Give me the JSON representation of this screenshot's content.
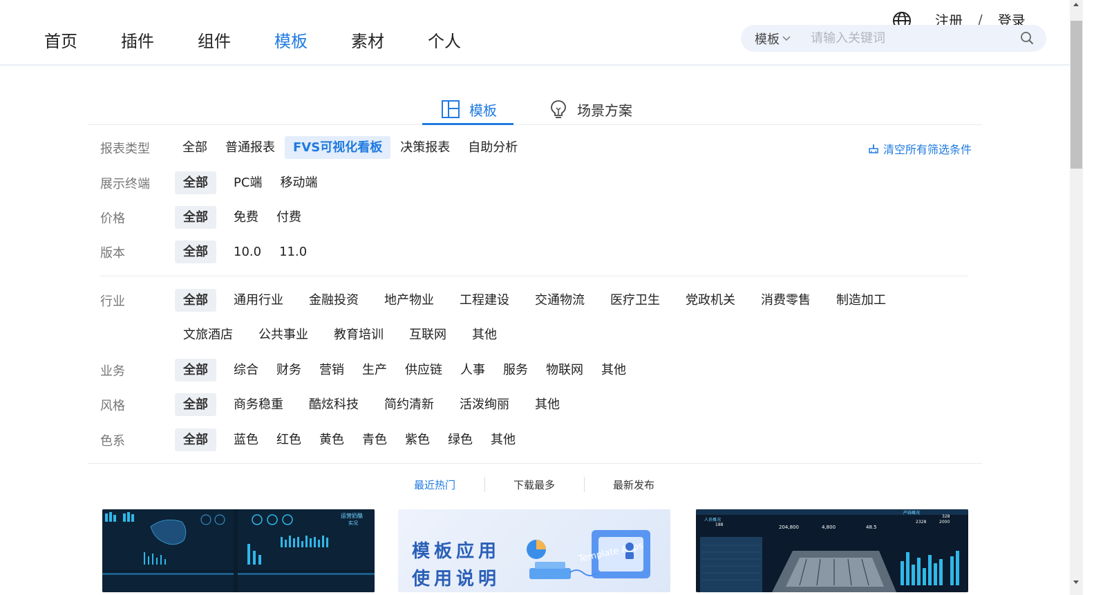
{
  "header": {
    "nav": [
      "首页",
      "插件",
      "组件",
      "模板",
      "素材",
      "个人"
    ],
    "active_nav": "模板",
    "register": "注册",
    "separator": "/",
    "login": "登录",
    "search": {
      "scope": "模板",
      "placeholder": "请输入关键词"
    }
  },
  "tabs": [
    {
      "label": "模板",
      "icon": "layout-icon"
    },
    {
      "label": "场景方案",
      "icon": "lightbulb-icon"
    }
  ],
  "clear_filters": "清空所有筛选条件",
  "filters": {
    "report_type": {
      "label": "报表类型",
      "options": [
        "全部",
        "普通报表",
        "FVS可视化看板",
        "决策报表",
        "自助分析"
      ],
      "selected": "FVS可视化看板"
    },
    "terminal": {
      "label": "展示终端",
      "options": [
        "全部",
        "PC端",
        "移动端"
      ],
      "selected": "全部"
    },
    "price": {
      "label": "价格",
      "options": [
        "全部",
        "免费",
        "付费"
      ],
      "selected": "全部"
    },
    "version": {
      "label": "版本",
      "options": [
        "全部",
        "10.0",
        "11.0"
      ],
      "selected": "全部"
    },
    "industry": {
      "label": "行业",
      "options_row1": [
        "全部",
        "通用行业",
        "金融投资",
        "地产物业",
        "工程建设",
        "交通物流",
        "医疗卫生",
        "党政机关",
        "消费零售",
        "制造加工"
      ],
      "options_row2": [
        "文旅酒店",
        "公共事业",
        "教育培训",
        "互联网",
        "其他"
      ],
      "selected": "全部"
    },
    "business": {
      "label": "业务",
      "options": [
        "全部",
        "综合",
        "财务",
        "营销",
        "生产",
        "供应链",
        "人事",
        "服务",
        "物联网",
        "其他"
      ],
      "selected": "全部"
    },
    "style": {
      "label": "风格",
      "options": [
        "全部",
        "商务稳重",
        "酷炫科技",
        "简约清新",
        "活泼绚丽",
        "其他"
      ],
      "selected": "全部"
    },
    "color": {
      "label": "色系",
      "options": [
        "全部",
        "蓝色",
        "红色",
        "黄色",
        "青色",
        "紫色",
        "绿色",
        "其他"
      ],
      "selected": "全部"
    }
  },
  "sort": [
    "最近热门",
    "下载最多",
    "最新发布"
  ],
  "active_sort": "最近热门",
  "cards": {
    "card2_title_line1": "模板应用",
    "card2_title_line2": "使用说明",
    "card2_badge": "Template Apps",
    "card1_labels": [
      "运营奶酪",
      "实况"
    ],
    "card3_labels": [
      "人员概况",
      "产线概况"
    ],
    "card3_values": [
      "204,800",
      "4,800",
      "48.5",
      "2328",
      "2000",
      "188",
      "328"
    ]
  },
  "colors": {
    "accent": "#1f7ae0",
    "selected_bg": "#e3edfb",
    "all_bg": "#eceff3"
  }
}
